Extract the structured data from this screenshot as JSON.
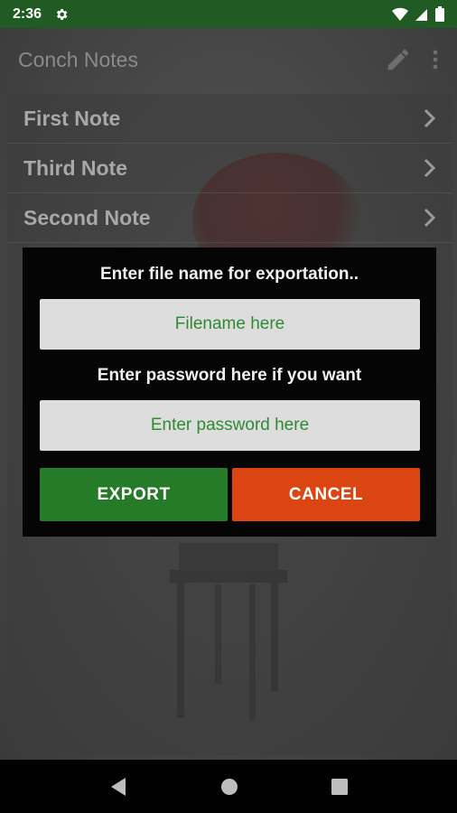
{
  "status_bar": {
    "time": "2:36",
    "icons": [
      "settings-icon",
      "wifi-icon",
      "signal-icon",
      "battery-icon"
    ]
  },
  "app_bar": {
    "title": "Conch Notes",
    "actions": [
      "edit-pencil-icon",
      "overflow-menu-icon"
    ]
  },
  "notes": [
    {
      "title": "First Note"
    },
    {
      "title": "Third Note"
    },
    {
      "title": "Second Note"
    }
  ],
  "dialog": {
    "filename_label": "Enter file name for exportation..",
    "filename_placeholder": "Filename here",
    "filename_value": "",
    "password_label": "Enter password here if you want",
    "password_placeholder": "Enter password here",
    "password_value": "",
    "export_label": "EXPORT",
    "cancel_label": "CANCEL"
  },
  "nav_bar": {
    "buttons": [
      "back-icon",
      "home-icon",
      "recents-icon"
    ]
  },
  "colors": {
    "status_bar": "#1f5b22",
    "export_button": "#267b28",
    "cancel_button": "#db4511",
    "field_text": "#2e7d32",
    "dialog_background": "#050505"
  }
}
